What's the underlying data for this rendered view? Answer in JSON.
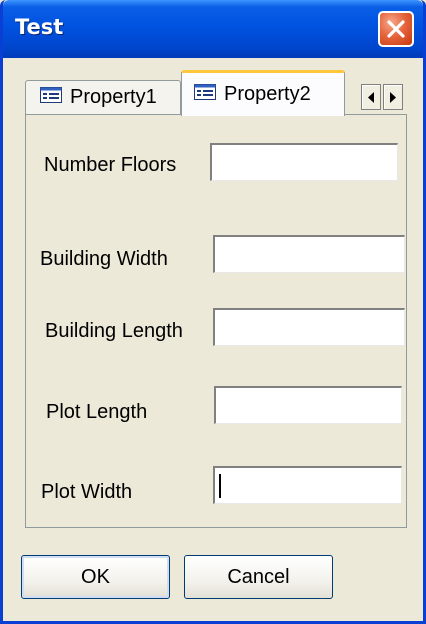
{
  "window": {
    "title": "Test"
  },
  "tabs": [
    {
      "label": "Property1",
      "icon": "property-page-icon",
      "selected": false
    },
    {
      "label": "Property2",
      "icon": "property-page-icon",
      "selected": true
    }
  ],
  "tab_scroll": {
    "left_icon": "arrow-left-icon",
    "right_icon": "arrow-right-icon"
  },
  "fields": [
    {
      "label": "Number Floors",
      "value": ""
    },
    {
      "label": "Building Width",
      "value": ""
    },
    {
      "label": "Building Length",
      "value": ""
    },
    {
      "label": "Plot Length",
      "value": ""
    },
    {
      "label": "Plot Width",
      "value": ""
    }
  ],
  "buttons": {
    "ok": "OK",
    "cancel": "Cancel"
  },
  "colors": {
    "titlebar": "#0052e0",
    "close_button": "#e5663e",
    "tab_highlight": "#ffc83c",
    "dialog_background": "#ece9d8"
  }
}
